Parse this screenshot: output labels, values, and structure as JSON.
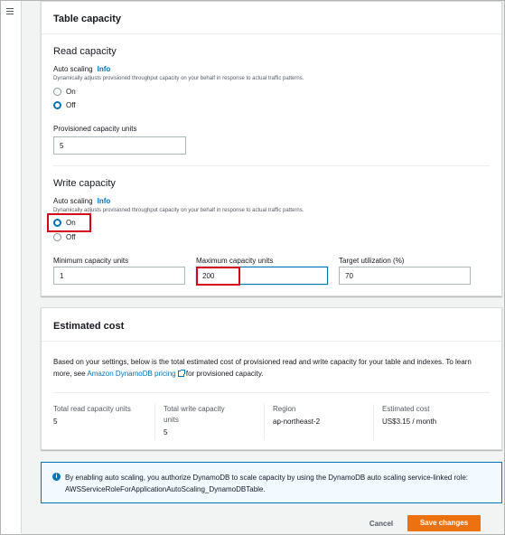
{
  "colors": {
    "accent": "#0073bb",
    "primary_button": "#ec7211",
    "highlight": "#d7001b",
    "alert_bg": "#f1faff"
  },
  "table_capacity": {
    "title": "Table capacity",
    "read": {
      "title": "Read capacity",
      "auto_scaling_label": "Auto scaling",
      "info_label": "Info",
      "description": "Dynamically adjusts provisioned throughput capacity on your behalf in response to actual traffic patterns.",
      "option_on": "On",
      "option_off": "Off",
      "selected": "Off",
      "provisioned_label": "Provisioned capacity units",
      "provisioned_value": "5"
    },
    "write": {
      "title": "Write capacity",
      "auto_scaling_label": "Auto scaling",
      "info_label": "Info",
      "description": "Dynamically adjusts provisioned throughput capacity on your behalf in response to actual traffic patterns.",
      "option_on": "On",
      "option_off": "Off",
      "selected": "On",
      "min_label": "Minimum capacity units",
      "min_value": "1",
      "max_label": "Maximum capacity units",
      "max_value": "200",
      "target_label": "Target utilization (%)",
      "target_value": "70"
    }
  },
  "estimated_cost": {
    "title": "Estimated cost",
    "body_before": "Based on your settings, below is the total estimated cost of provisioned read and write capacity for your table and indexes. To learn more, see ",
    "link_text": "Amazon DynamoDB pricing",
    "body_after": " for provisioned capacity.",
    "columns": [
      {
        "label": "Total read capacity units",
        "value": "5"
      },
      {
        "label": "Total write capacity units",
        "value": "5"
      },
      {
        "label": "Region",
        "value": "ap-northeast-2"
      },
      {
        "label": "Estimated cost",
        "value": "US$3.15 / month"
      }
    ]
  },
  "alert": {
    "icon": "info-icon",
    "text": "By enabling auto scaling, you authorize DynamoDB to scale capacity by using the DynamoDB auto scaling service-linked role: AWSServiceRoleForApplicationAutoScaling_DynamoDBTable."
  },
  "footer": {
    "cancel_label": "Cancel",
    "save_label": "Save changes"
  },
  "nav": {
    "menu_icon": "hamburger-menu-icon"
  }
}
